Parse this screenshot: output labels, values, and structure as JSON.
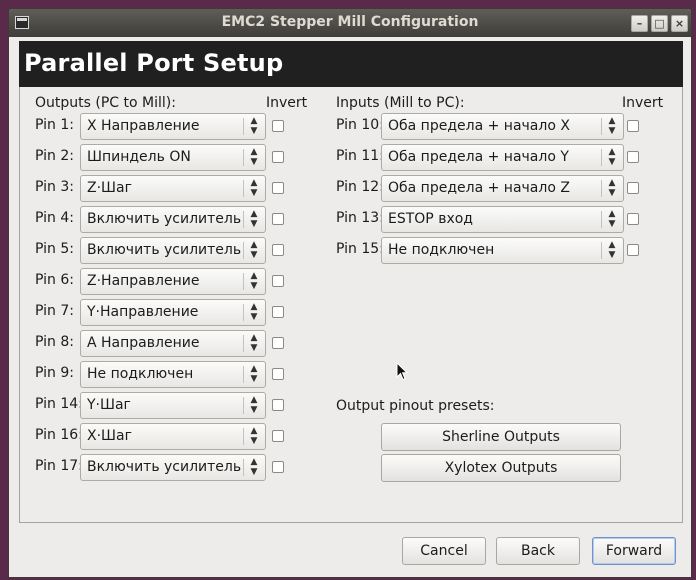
{
  "window": {
    "title": "EMC2 Stepper Mill Configuration"
  },
  "header": {
    "title": "Parallel Port Setup"
  },
  "outputs": {
    "heading": "Outputs (PC to Mill):",
    "invert_label": "Invert",
    "pins": [
      {
        "label": "Pin 1:",
        "value": "X Направление",
        "inverted": false
      },
      {
        "label": "Pin 2:",
        "value": "Шпиндель ON",
        "inverted": false
      },
      {
        "label": "Pin 3:",
        "value": "Z·Шаг",
        "inverted": false
      },
      {
        "label": "Pin 4:",
        "value": "Включить усилитель",
        "inverted": false
      },
      {
        "label": "Pin 5:",
        "value": "Включить усилитель",
        "inverted": false
      },
      {
        "label": "Pin 6:",
        "value": "Z·Направление",
        "inverted": false
      },
      {
        "label": "Pin 7:",
        "value": "Y·Направление",
        "inverted": false
      },
      {
        "label": "Pin 8:",
        "value": "A Направление",
        "inverted": false
      },
      {
        "label": "Pin 9:",
        "value": "Не подключен",
        "inverted": false
      },
      {
        "label": "Pin 14:",
        "value": "Y·Шаг",
        "inverted": false
      },
      {
        "label": "Pin 16:",
        "value": "X·Шаг",
        "inverted": false
      },
      {
        "label": "Pin 17:",
        "value": "Включить усилитель",
        "inverted": false
      }
    ]
  },
  "inputs": {
    "heading": "Inputs (Mill to PC):",
    "invert_label": "Invert",
    "pins": [
      {
        "label": "Pin 10:",
        "value": "Оба предела + начало X",
        "inverted": false
      },
      {
        "label": "Pin 11:",
        "value": "Оба предела + начало Y",
        "inverted": false
      },
      {
        "label": "Pin 12:",
        "value": "Оба предела + начало Z",
        "inverted": false
      },
      {
        "label": "Pin 13:",
        "value": "ESTOP вход",
        "inverted": false
      },
      {
        "label": "Pin 15:",
        "value": "Не подключен",
        "inverted": false
      }
    ]
  },
  "presets": {
    "heading": "Output pinout presets:",
    "sherline_label": "Sherline Outputs",
    "xylotex_label": "Xylotex Outputs"
  },
  "footer": {
    "cancel_label": "Cancel",
    "back_label": "Back",
    "forward_label": "Forward"
  },
  "icons": {
    "combo_arrow": "updown-arrows-icon",
    "window_icon": "window-menu-icon",
    "minimize": "minimize-icon",
    "maximize": "maximize-icon",
    "close": "close-icon"
  }
}
